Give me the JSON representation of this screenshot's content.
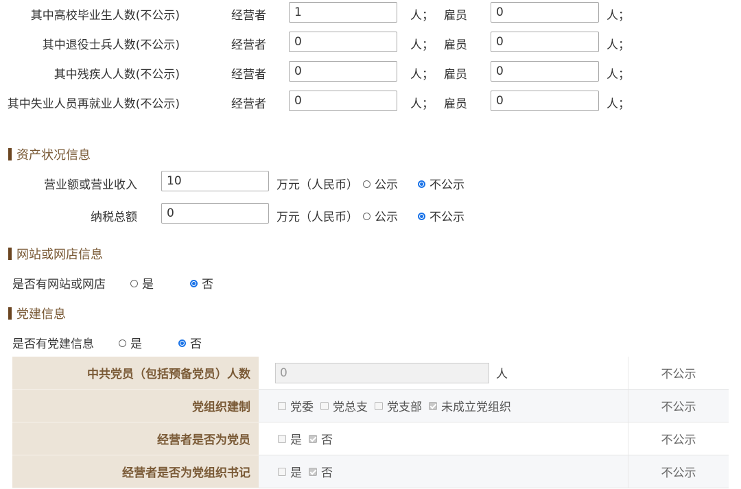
{
  "employment_rows": [
    {
      "label": "其中高校毕业生人数(不公示)",
      "operator_label": "经营者",
      "operator_value": "1",
      "unit1": "人；",
      "employee_label": "雇员",
      "employee_value": "0",
      "unit2": "人；"
    },
    {
      "label": "其中退役士兵人数(不公示)",
      "operator_label": "经营者",
      "operator_value": "0",
      "unit1": "人；",
      "employee_label": "雇员",
      "employee_value": "0",
      "unit2": "人；"
    },
    {
      "label": "其中残疾人人数(不公示)",
      "operator_label": "经营者",
      "operator_value": "0",
      "unit1": "人；",
      "employee_label": "雇员",
      "employee_value": "0",
      "unit2": "人；"
    },
    {
      "label": "其中失业人员再就业人数(不公示)",
      "operator_label": "经营者",
      "operator_value": "0",
      "unit1": "人；",
      "employee_label": "雇员",
      "employee_value": "0",
      "unit2": "人；"
    }
  ],
  "assets": {
    "title": "资产状况信息",
    "rows": [
      {
        "label": "营业额或营业收入",
        "value": "10",
        "unit": "万元（人民币）",
        "public": "公示",
        "private": "不公示",
        "selected": "private"
      },
      {
        "label": "纳税总额",
        "value": "0",
        "unit": "万元（人民币）",
        "public": "公示",
        "private": "不公示",
        "selected": "private"
      }
    ]
  },
  "website": {
    "title": "网站或网店信息",
    "question": "是否有网站或网店",
    "yes": "是",
    "no": "否",
    "selected": "no"
  },
  "party": {
    "title": "党建信息",
    "question": "是否有党建信息",
    "yes": "是",
    "no": "否",
    "selected": "no",
    "table": {
      "members_label": "中共党员（包括预备党员）人数",
      "members_value": "0",
      "members_unit": "人",
      "org_label": "党组织建制",
      "org_options": [
        {
          "label": "党委",
          "checked": false
        },
        {
          "label": "党总支",
          "checked": false
        },
        {
          "label": "党支部",
          "checked": false
        },
        {
          "label": "未成立党组织",
          "checked": true
        }
      ],
      "is_member_label": "经营者是否为党员",
      "is_secretary_label": "经营者是否为党组织书记",
      "yes": "是",
      "no": "否",
      "not_public": "不公示"
    }
  }
}
